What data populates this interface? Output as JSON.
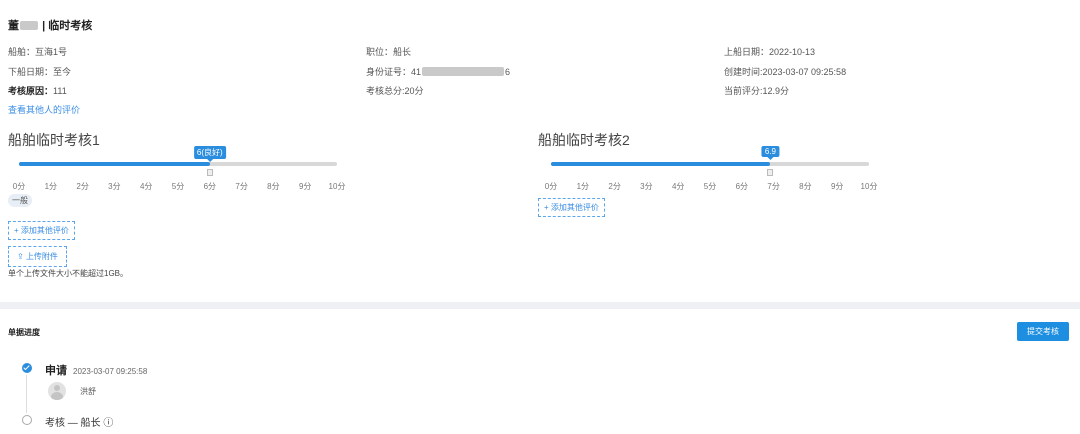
{
  "header": {
    "name_prefix": "董",
    "title_suffix": "| 临时考核"
  },
  "info": {
    "ship": "船舶：互海1号",
    "position": "职位：船长",
    "board_date": "上船日期：2022-10-13",
    "leave_date": "下船日期：至今",
    "id_label": "身份证号：41",
    "id_tail": "6",
    "created": "创建时间:2023-03-07 09:25:58",
    "reason_label": "考核原因：",
    "reason_value": "111",
    "total": "考核总分:20分",
    "current": "当前评分:12.9分",
    "view_others": "查看其他人的评价"
  },
  "sections": [
    {
      "title": "船舶临时考核1",
      "value": 6,
      "max": 10,
      "tip": "6(良好)",
      "tag": "一般",
      "add_btn": "+ 添加其他评价"
    },
    {
      "title": "船舶临时考核2",
      "value": 6.9,
      "max": 10,
      "tip": "6.9",
      "add_btn": "+ 添加其他评价"
    }
  ],
  "ticks": [
    "0分",
    "1分",
    "2分",
    "3分",
    "4分",
    "5分",
    "6分",
    "7分",
    "8分",
    "9分",
    "10分"
  ],
  "upload": {
    "button": "上传附件",
    "note": "单个上传文件大小不能超过1GB。"
  },
  "progress": {
    "heading": "单据进度",
    "submit": "提交考核",
    "step1_title": "申请",
    "step1_time": "2023-03-07 09:25:58",
    "step1_user": "洪舒",
    "step2_title": "考核 — 船长 ⓘ"
  },
  "colors": {
    "accent": "#2b8ddd",
    "track": "#d8d8d8"
  }
}
